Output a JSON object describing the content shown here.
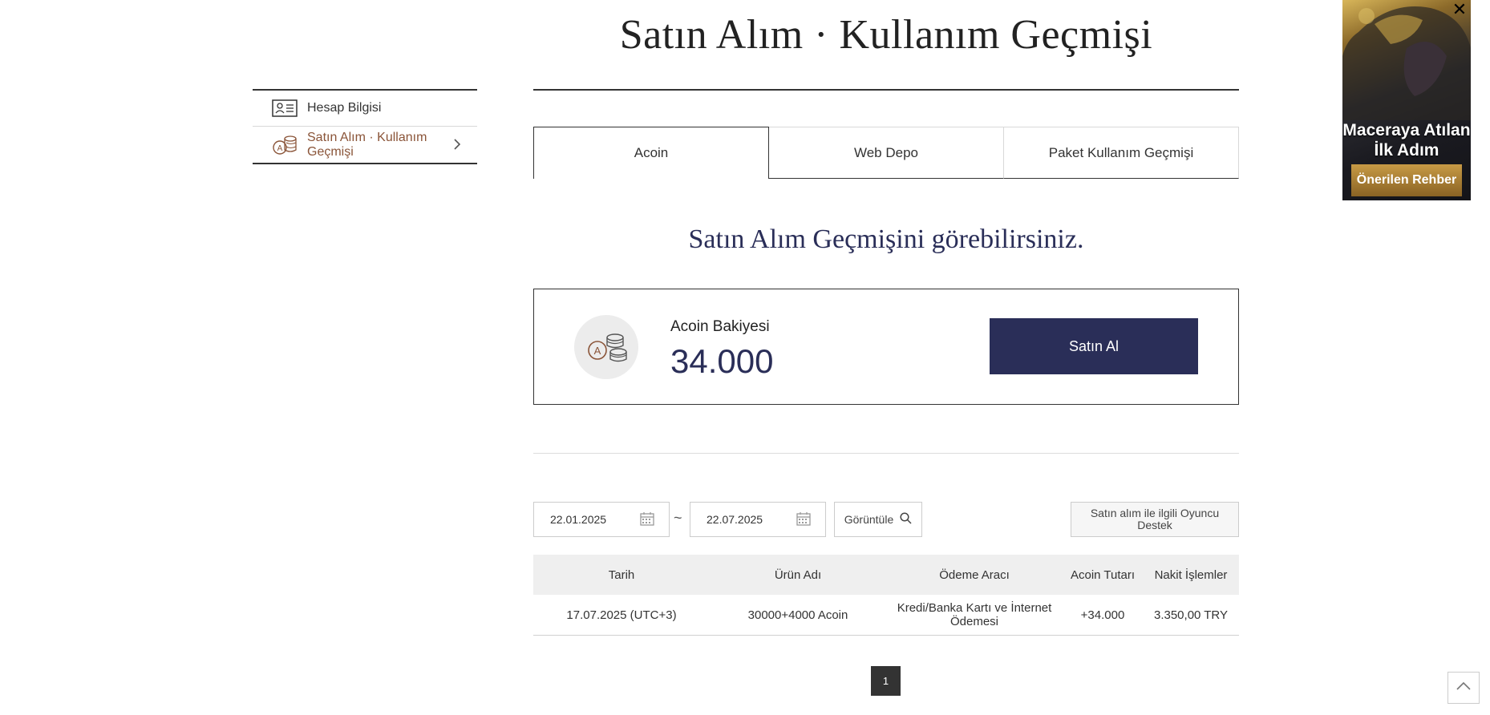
{
  "page": {
    "title": "Satın Alım · Kullanım Geçmişi",
    "subtitle": "Satın Alım Geçmişini görebilirsiniz."
  },
  "sidebar": {
    "items": [
      {
        "label": "Hesap Bilgisi",
        "icon": "id-card-icon"
      },
      {
        "label": "Satın Alım · Kullanım Geçmişi",
        "icon": "coins-icon"
      }
    ]
  },
  "tabs": [
    {
      "label": "Acoin"
    },
    {
      "label": "Web Depo"
    },
    {
      "label": "Paket Kullanım Geçmişi"
    }
  ],
  "balance": {
    "label": "Acoin Bakiyesi",
    "value": "34.000",
    "buy_label": "Satın Al"
  },
  "filter": {
    "start_date": "22.01.2025",
    "end_date": "22.07.2025",
    "separator": "~",
    "view_label": "Görüntüle",
    "support_label": "Satın alım ile ilgili Oyuncu Destek"
  },
  "table": {
    "headers": [
      "Tarih",
      "Ürün Adı",
      "Ödeme Aracı",
      "Acoin Tutarı",
      "Nakit İşlemler"
    ],
    "rows": [
      [
        "17.07.2025 (UTC+3)",
        "30000+4000 Acoin",
        "Kredi/Banka Kartı ve İnternet Ödemesi",
        "+34.000",
        "3.350,00 TRY"
      ]
    ]
  },
  "pagination": {
    "current": "1"
  },
  "ad": {
    "title": "Maceraya Atılan İlk Adım",
    "button_label": "Önerilen Rehber"
  },
  "colors": {
    "accent": "#2a2e58",
    "sidebar_active": "#8a5438"
  }
}
